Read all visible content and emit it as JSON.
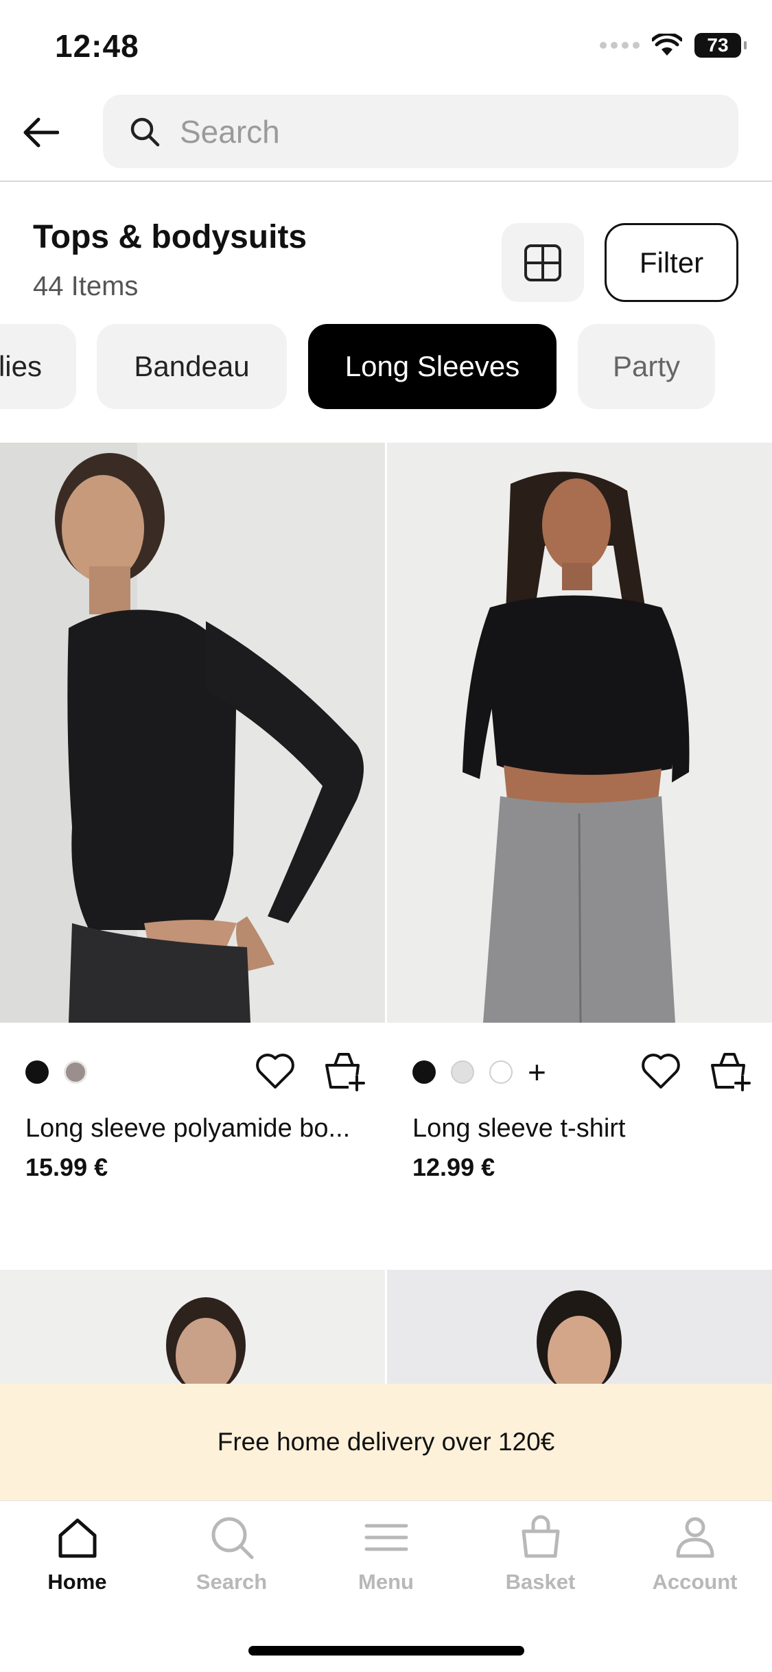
{
  "status": {
    "time": "12:48",
    "battery": "73"
  },
  "search": {
    "placeholder": "Search"
  },
  "category": {
    "title": "Tops & bodysuits",
    "count": "44 Items",
    "filter_label": "Filter"
  },
  "chips": [
    {
      "label": "lies"
    },
    {
      "label": "Bandeau"
    },
    {
      "label": "Long Sleeves",
      "active": true
    },
    {
      "label": "Party"
    }
  ],
  "products": [
    {
      "name": "Long sleeve polyamide bo...",
      "price": "15.99 €",
      "swatches": [
        "#111111",
        "#9a8f8c"
      ]
    },
    {
      "name": "Long sleeve t-shirt",
      "price": "12.99 €",
      "swatches": [
        "#111111",
        "#e0e0e0",
        "#ffffff"
      ],
      "more": "+"
    }
  ],
  "banner": {
    "text": "Free home delivery over 120€"
  },
  "tabs": [
    {
      "label": "Home",
      "icon": "home-icon",
      "active": true
    },
    {
      "label": "Search",
      "icon": "search-icon"
    },
    {
      "label": "Menu",
      "icon": "menu-icon"
    },
    {
      "label": "Basket",
      "icon": "basket-icon"
    },
    {
      "label": "Account",
      "icon": "account-icon"
    }
  ]
}
